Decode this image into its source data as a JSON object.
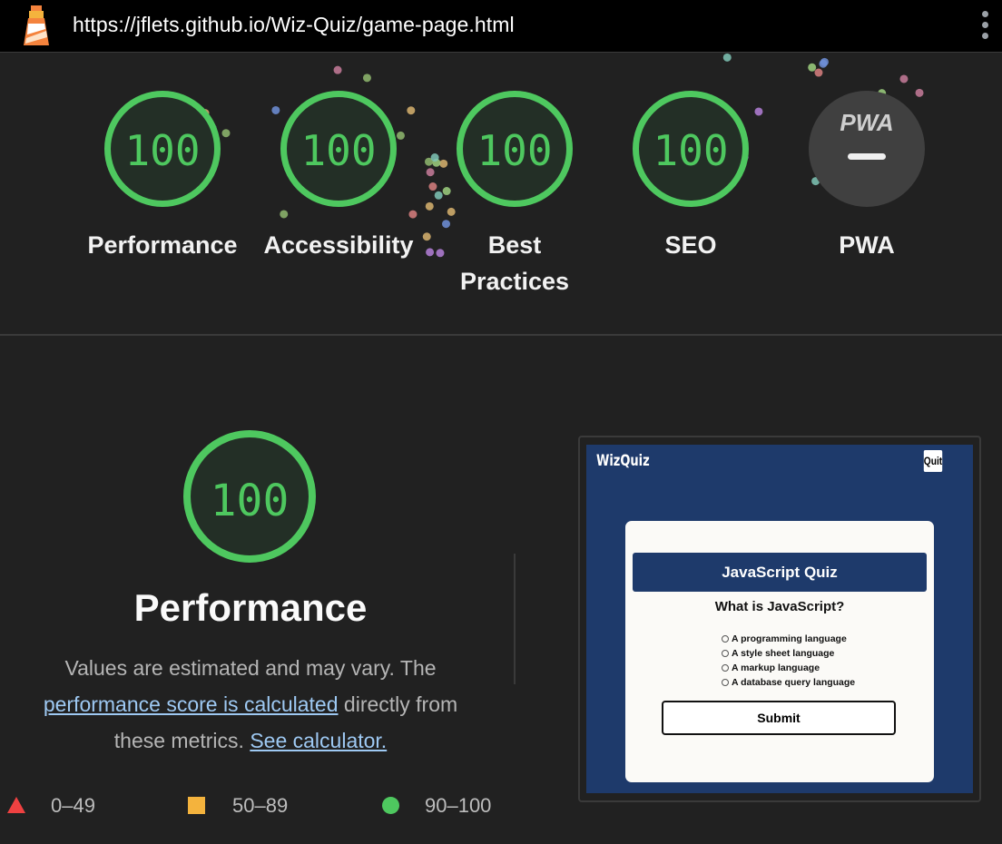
{
  "browser": {
    "url": "https://jflets.github.io/Wiz-Quiz/game-page.html",
    "logo_icon": "lighthouse-icon",
    "menu_icon": "kebab-menu-icon"
  },
  "gauges": [
    {
      "label": "Performance",
      "score": "100"
    },
    {
      "label": "Accessibility",
      "score": "100"
    },
    {
      "label": "Best Practices",
      "score": "100"
    },
    {
      "label": "SEO",
      "score": "100"
    },
    {
      "label": "PWA",
      "badge": "PWA"
    }
  ],
  "performance_section": {
    "score": "100",
    "title": "Performance",
    "desc_prefix": "Values are estimated and may vary. The",
    "desc_link": "performance score is calculated",
    "desc_middle": "directly from these metrics.",
    "desc_link2": "See calculator."
  },
  "legend": [
    {
      "label": "0–49",
      "shape": "triangle",
      "color": "#ef4141"
    },
    {
      "label": "50–89",
      "shape": "square",
      "color": "#f4b33d"
    },
    {
      "label": "90–100",
      "shape": "circle",
      "color": "#4ec85f"
    }
  ],
  "screenshot": {
    "brand": "WizQuiz",
    "quit": "Quit",
    "quiz_title": "JavaScript Quiz",
    "question": "What is JavaScript?",
    "options": [
      "A programming language",
      "A style sheet language",
      "A markup language",
      "A database query language"
    ],
    "submit": "Submit"
  },
  "colors": {
    "pass": "#4ec85f",
    "average": "#f4b33d",
    "fail": "#ef4141",
    "background": "#212121",
    "link": "#9ec9f3",
    "quiz_blue": "#1e3a6b"
  }
}
